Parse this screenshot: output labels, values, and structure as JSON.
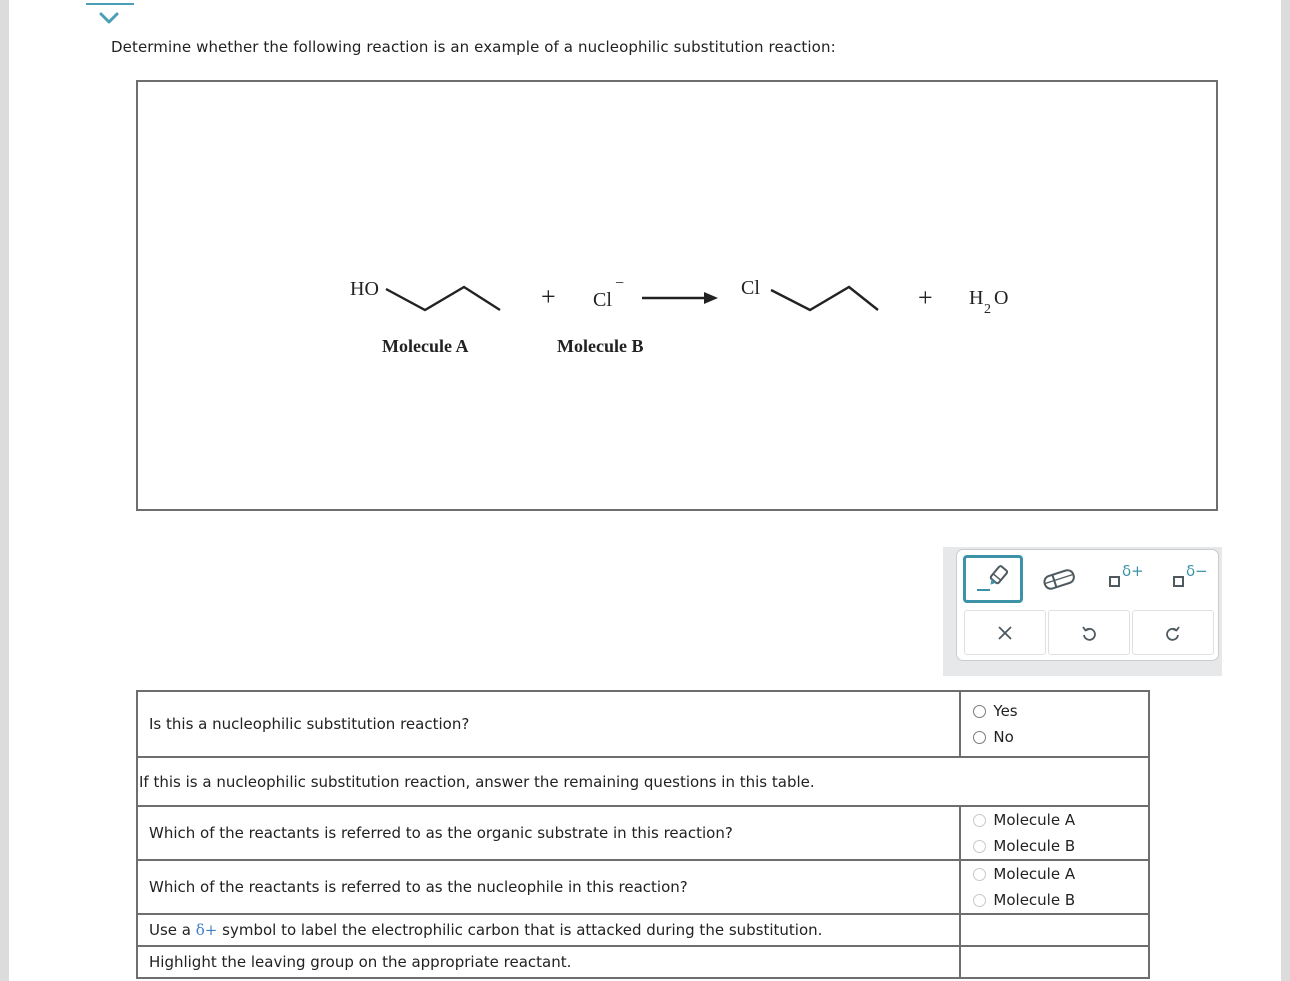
{
  "header": {
    "collapse_icon": "chevron-down-icon",
    "prompt": "Determine whether the following reaction is an example of a nucleophilic substitution reaction:"
  },
  "reaction": {
    "molecule_a": {
      "label": "Molecule A",
      "group": "HO",
      "structure": "propan-1-ol skeletal"
    },
    "plus_1": "+",
    "molecule_b": {
      "label": "Molecule B",
      "atom": "Cl",
      "charge": "−"
    },
    "arrow": "reaction-arrow-icon",
    "product_1": {
      "group": "Cl",
      "structure": "1-chloropropane skeletal"
    },
    "plus_2": "+",
    "product_2": {
      "h": "H",
      "sub": "2",
      "o": "O"
    }
  },
  "toolbar": {
    "tools": [
      {
        "name": "highlighter",
        "icon": "highlighter-icon",
        "selected": true
      },
      {
        "name": "eraser",
        "icon": "eraser-icon",
        "selected": false
      },
      {
        "name": "delta-plus",
        "icon": "delta-plus-icon",
        "symbol": "δ+"
      },
      {
        "name": "delta-minus",
        "icon": "delta-minus-icon",
        "symbol": "δ−"
      }
    ],
    "actions": [
      {
        "name": "clear",
        "icon": "close-icon",
        "glyph": "×"
      },
      {
        "name": "undo",
        "icon": "undo-icon"
      },
      {
        "name": "redo",
        "icon": "redo-icon"
      }
    ]
  },
  "table": {
    "q1": {
      "question": "Is this a nucleophilic substitution reaction?",
      "options": [
        "Yes",
        "No"
      ]
    },
    "instruction": "If this is a nucleophilic substitution reaction, answer the remaining questions in this table.",
    "q2": {
      "question": "Which of the reactants is referred to as the organic substrate in this reaction?",
      "options": [
        "Molecule A",
        "Molecule B"
      ]
    },
    "q3": {
      "question": "Which of the reactants is referred to as the nucleophile in this reaction?",
      "options": [
        "Molecule A",
        "Molecule B"
      ]
    },
    "q4": {
      "prefix": "Use a ",
      "delta": "δ+",
      "suffix": " symbol to label the electrophilic carbon that is attacked during the substitution."
    },
    "q5": {
      "question": "Highlight the leaving group on the appropriate reactant."
    }
  },
  "colors": {
    "accent": "#3c93a8",
    "delta_inline": "#3c7fc4",
    "border": "#6e6e6e",
    "toolbar_bg": "#e6e8ea"
  }
}
